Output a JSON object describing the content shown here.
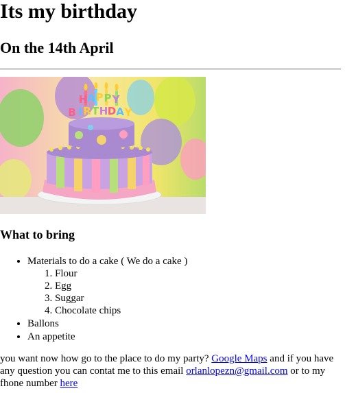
{
  "page": {
    "title": "Its my birthday",
    "subtitle": "On the 14th April"
  },
  "hero_image": {
    "cake_topper_text": "HAPPY BIRTHDAY",
    "colors": {
      "background_pink": "#f6b3c9",
      "background_yellow": "#f2e56b",
      "background_green": "#b9dc6a",
      "cake_purple": "#a98ad0",
      "cake_frill_pink": "#f4a6c4",
      "plate_white": "#f2f2f2"
    }
  },
  "bring": {
    "heading": "What to bring",
    "items": [
      {
        "label": "Materials to do a cake ( We do a cake )",
        "sub": [
          "Flour",
          "Egg",
          "Suggar",
          "Chocolate chips"
        ]
      },
      {
        "label": "Ballons"
      },
      {
        "label": "An appetite"
      }
    ]
  },
  "footer": {
    "text_1": "you want now how go to the place to do my party? ",
    "link_maps": "Google Maps",
    "text_2": " and if you have any question you can contat me to this email ",
    "link_email": "orlanlopezn@gmail.com",
    "text_3": " or to my fhone number ",
    "link_phone": "here"
  }
}
